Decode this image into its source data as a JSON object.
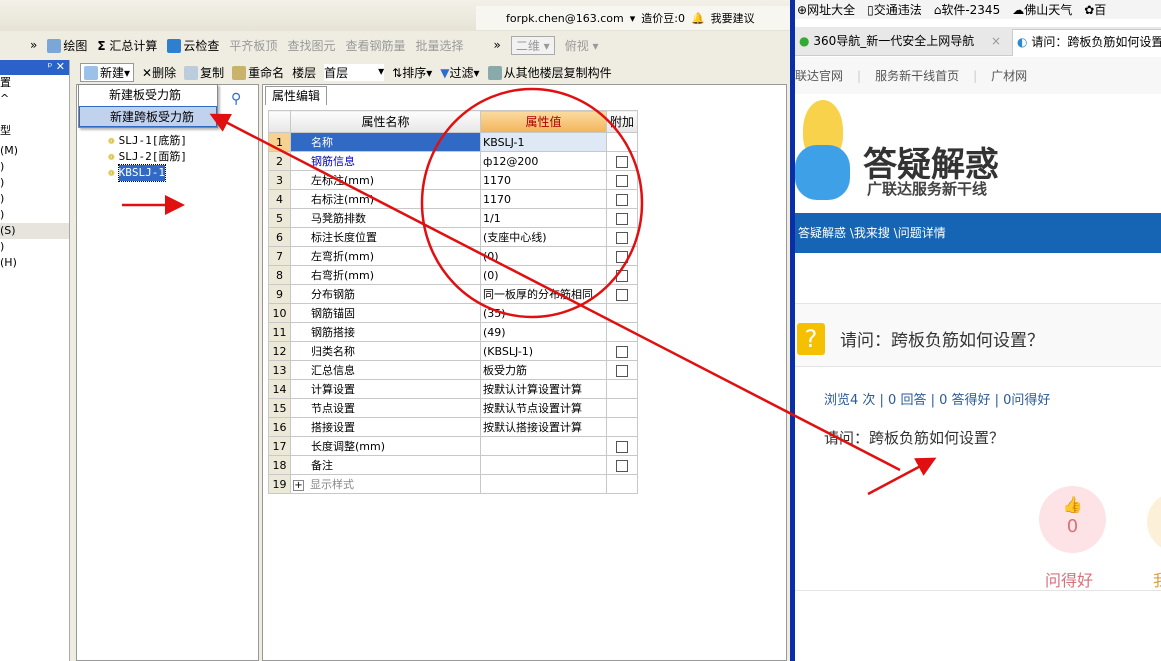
{
  "app": {
    "user": {
      "email": "forpk.chen@163.com",
      "beans": "造价豆:0",
      "suggest": "我要建议"
    },
    "toolbar1": {
      "draw": "绘图",
      "sum": "汇总计算",
      "cloud": "云检查",
      "align": "平齐板顶",
      "find": "查找图元",
      "view_rebar": "查看钢筋量",
      "batch": "批量选择",
      "view2d": "二维",
      "top_view": "俯视"
    },
    "toolbar2": {
      "new": "新建",
      "delete": "删除",
      "copy": "复制",
      "rename": "重命名",
      "floor_label": "楼层",
      "floor_value": "首层",
      "sort": "排序",
      "filter": "过滤",
      "copy_floor": "从其他楼层复制构件"
    },
    "new_menu": [
      "新建板受力筋",
      "新建跨板受力筋"
    ],
    "left_items": [
      "置",
      "^",
      "",
      "型",
      "(M)",
      ")",
      ")",
      ")",
      ")",
      "(S)",
      ")",
      "(H)"
    ],
    "tree": [
      "SLJ-1[底筋]",
      "SLJ-2[面筋]",
      "KBSLJ-1"
    ],
    "prop_tab": "属性编辑",
    "grid_headers": {
      "name": "属性名称",
      "value": "属性值",
      "extra": "附加"
    },
    "rows": [
      {
        "n": "1",
        "name": "名称",
        "value": "KBSLJ-1",
        "cb": false
      },
      {
        "n": "2",
        "name": "钢筋信息",
        "value": "ф12@200",
        "cb": true
      },
      {
        "n": "3",
        "name": "左标注(mm)",
        "value": "1170",
        "cb": true
      },
      {
        "n": "4",
        "name": "右标注(mm)",
        "value": "1170",
        "cb": true
      },
      {
        "n": "5",
        "name": "马凳筋排数",
        "value": "1/1",
        "cb": true
      },
      {
        "n": "6",
        "name": "标注长度位置",
        "value": "(支座中心线)",
        "cb": true
      },
      {
        "n": "7",
        "name": "左弯折(mm)",
        "value": "(0)",
        "cb": true
      },
      {
        "n": "8",
        "name": "右弯折(mm)",
        "value": "(0)",
        "cb": true
      },
      {
        "n": "9",
        "name": "分布钢筋",
        "value": "同一板厚的分布筋相同",
        "cb": true
      },
      {
        "n": "10",
        "name": "钢筋锚固",
        "value": "(35)",
        "cb": false
      },
      {
        "n": "11",
        "name": "钢筋搭接",
        "value": "(49)",
        "cb": false
      },
      {
        "n": "12",
        "name": "归类名称",
        "value": "(KBSLJ-1)",
        "cb": true
      },
      {
        "n": "13",
        "name": "汇总信息",
        "value": "板受力筋",
        "cb": true
      },
      {
        "n": "14",
        "name": "计算设置",
        "value": "按默认计算设置计算",
        "cb": false
      },
      {
        "n": "15",
        "name": "节点设置",
        "value": "按默认节点设置计算",
        "cb": false
      },
      {
        "n": "16",
        "name": "搭接设置",
        "value": "按默认搭接设置计算",
        "cb": false
      },
      {
        "n": "17",
        "name": "长度调整(mm)",
        "value": "",
        "cb": true
      },
      {
        "n": "18",
        "name": "备注",
        "value": "",
        "cb": true
      },
      {
        "n": "19",
        "name": "显示样式",
        "value": "",
        "cb": false
      }
    ]
  },
  "browser": {
    "bookmarks": [
      "网址大全",
      "交通违法",
      "软件-2345",
      "佛山天气",
      "百"
    ],
    "tabs": [
      "360导航_新一代安全上网导航",
      "请问：跨板负筋如何设置"
    ],
    "nav": [
      "联达官网",
      "服务新干线首页",
      "广材网"
    ],
    "logo": {
      "title": "答疑解惑",
      "subtitle": "广联达服务新干线"
    },
    "breadcrumb": "答疑解惑 \\我来搜 \\问题详情",
    "question_title": "请问：跨板负筋如何设置？",
    "stats": "浏览4 次 | 0 回答 | 0 答得好 | 0问得好",
    "question_text": "请问：跨板负筋如何设置？",
    "like_count": "0",
    "like_label": "问得好",
    "second_label": "我"
  },
  "colors": {
    "annotation": "#e01010",
    "selection": "#316ac5",
    "breadcrumb_bar": "#1565b4"
  }
}
